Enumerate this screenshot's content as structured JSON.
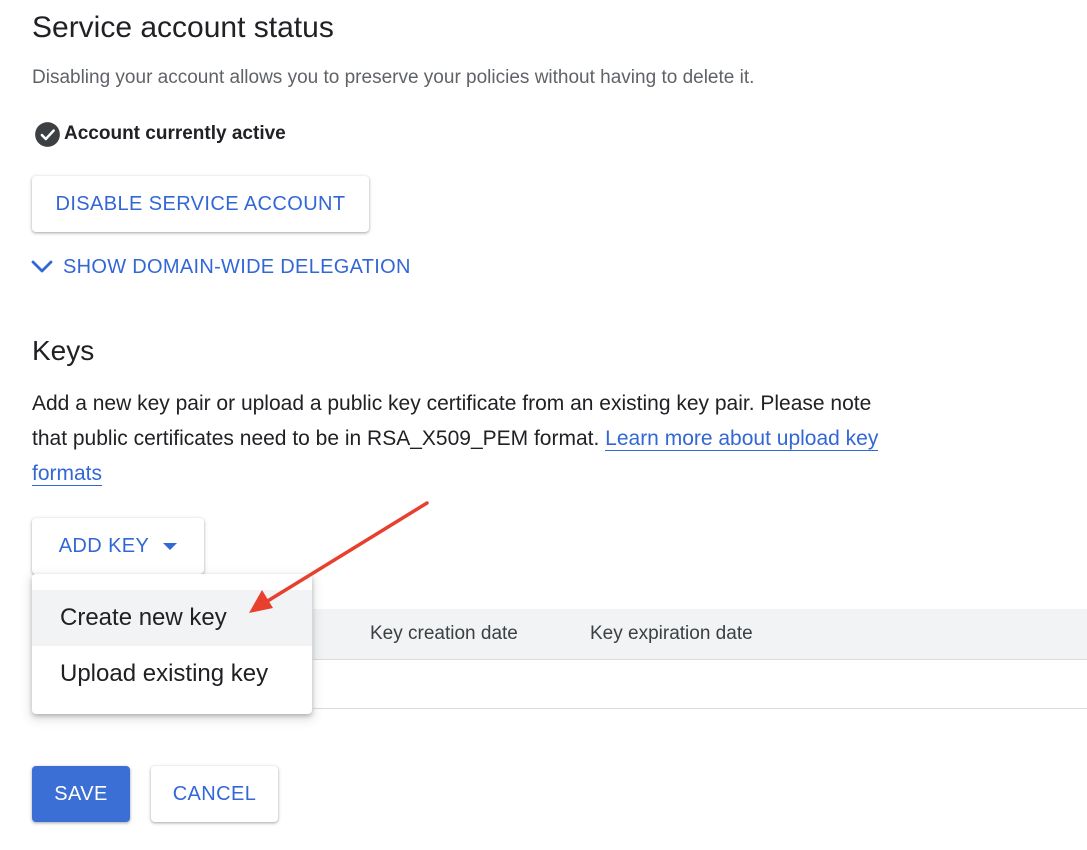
{
  "status_section": {
    "title": "Service account status",
    "description": "Disabling your account allows you to preserve your policies without having to delete it.",
    "status_text": "Account currently active",
    "status_icon": "check-circle-icon",
    "disable_button_label": "DISABLE SERVICE ACCOUNT",
    "delegation_toggle_label": "SHOW DOMAIN-WIDE DELEGATION"
  },
  "keys_section": {
    "title": "Keys",
    "description": "Add a new key pair or upload a public key certificate from an existing key pair. Please note that public certificates need to be in RSA_X509_PEM format.",
    "learn_more_link": "Learn more about upload key formats",
    "add_key_button_label": "ADD KEY",
    "add_key_menu": [
      {
        "label": "Create new key",
        "highlighted": true
      },
      {
        "label": "Upload existing key",
        "highlighted": false
      }
    ],
    "table": {
      "columns": [
        "Key creation date",
        "Key expiration date"
      ]
    }
  },
  "footer": {
    "save_label": "SAVE",
    "cancel_label": "CANCEL"
  },
  "colors": {
    "accent": "#3367d6",
    "primary_button": "#3b6fd5",
    "annotation_arrow": "#e8402f"
  }
}
